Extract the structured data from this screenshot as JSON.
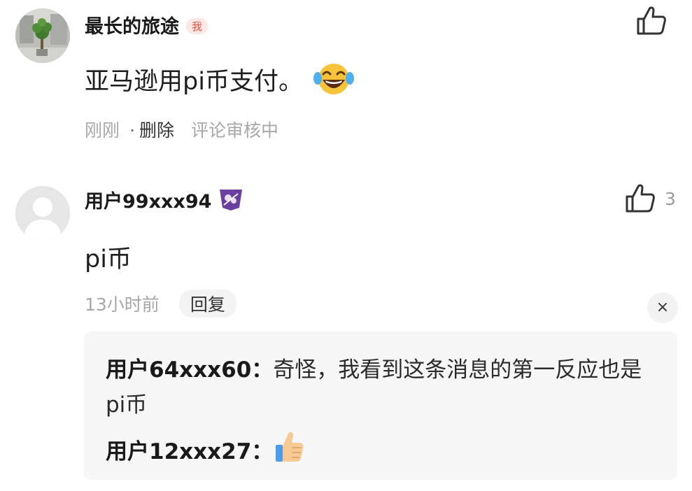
{
  "comments": [
    {
      "user": "最长的旅途",
      "me_badge": "我",
      "text": "亚马逊用pi币支付。",
      "emoji_icon": "laughing-tears-emoji",
      "time": "刚刚",
      "separator": "·",
      "delete_label": "删除",
      "status": "评论审核中",
      "like_icon": "thumbs-up-outline"
    },
    {
      "user": "用户99xxx94",
      "level_badge_icon": "purple-level-badge",
      "text": "pi币",
      "time": "13小时前",
      "reply_label": "回复",
      "like_count": "3",
      "like_icon": "thumbs-up-outline",
      "close_label": "×",
      "replies": [
        {
          "user": "用户64xxx60",
          "colon": "：",
          "text": "奇怪，我看到这条消息的第一反应也是pi币"
        },
        {
          "user": "用户12xxx27",
          "colon": "：",
          "emoji_icon": "thumbs-up-emoji"
        }
      ]
    }
  ],
  "colors": {
    "me_badge": "#e0533f",
    "meta_gray": "#a7a7a7",
    "reply_bg": "#f6f6f6",
    "level_badge": "#6b3fa0"
  }
}
